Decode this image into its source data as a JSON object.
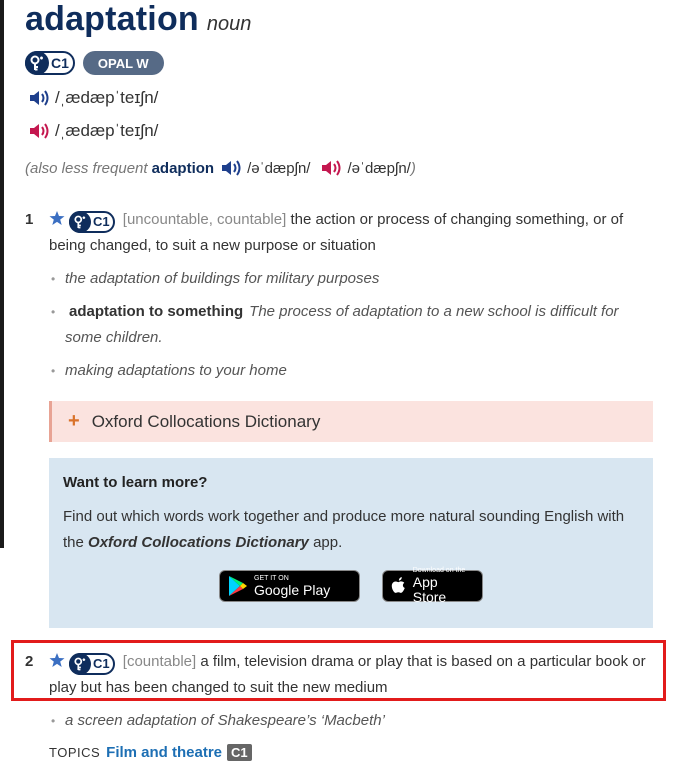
{
  "entry": {
    "headword": "adaptation",
    "pos": "noun",
    "level": "C1",
    "opal": "OPAL W",
    "pron_br": "/ˌædæpˈteɪʃn/",
    "pron_us": "/ˌædæpˈteɪʃn/"
  },
  "variant": {
    "prefix": "(also less frequent",
    "word": "adaption",
    "pron_br": "/əˈdæpʃn/",
    "pron_us": "/əˈdæpʃn/",
    "suffix": ")"
  },
  "sense1": {
    "num": "1",
    "level": "C1",
    "grammar": "[uncountable, countable]",
    "def": "the action or process of changing something, or of being changed, to suit a new purpose or situation",
    "examples": [
      "the adaptation of buildings for military purposes",
      "The process of adaptation to a new school is difficult for some children.",
      "making adaptations to your home"
    ],
    "collocation_form": "adaptation to something"
  },
  "collocations": {
    "label": "Oxford Collocations Dictionary"
  },
  "learn_more": {
    "title": "Want to learn more?",
    "text_before": "Find out which words work together and produce more natural sounding English with the",
    "app_name": "Oxford Collocations Dictionary",
    "text_after": "app.",
    "google_small": "GET IT ON",
    "google_big": "Google Play",
    "apple_small": "Download on the",
    "apple_big": "App Store"
  },
  "sense2": {
    "num": "2",
    "level": "C1",
    "grammar": "[countable]",
    "def": "a film, television drama or play that is based on a particular book or play but has been changed to suit the new medium",
    "example": "a screen adaptation of Shakespeare’s ‘Macbeth’"
  },
  "topics": {
    "label": "TOPICS",
    "link": "Film and theatre",
    "level": "C1"
  },
  "colors": {
    "headword": "#0f2d5c",
    "speaker_br": "#1e3f8c",
    "speaker_us": "#c4174f",
    "highlight": "#e21b1b",
    "collocation_bg": "#fbe3df",
    "learn_bg": "#d8e6f1"
  }
}
